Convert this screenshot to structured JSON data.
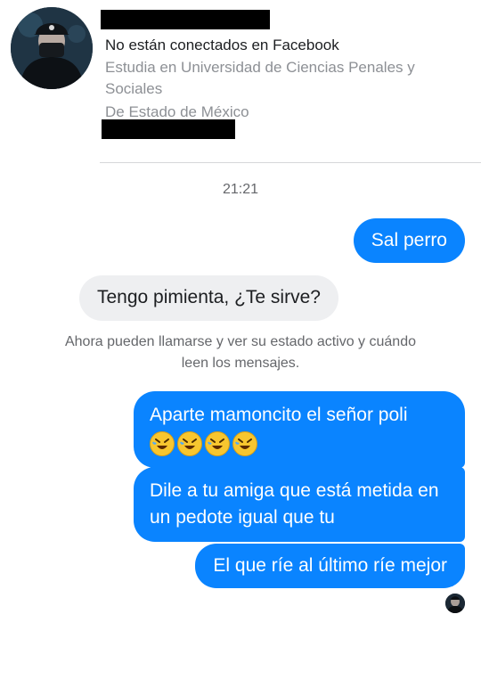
{
  "contact": {
    "status_line": "No están conectados en Facebook",
    "education": "Estudia en Universidad de Ciencias Penales y Sociales",
    "location": "De Estado de México"
  },
  "conversation": {
    "timestamp": "21:21",
    "messages": [
      {
        "direction": "outgoing",
        "text": "Sal perro"
      },
      {
        "direction": "incoming",
        "text": "Tengo pimienta, ¿Te sirve?"
      },
      {
        "direction": "outgoing",
        "text": "Aparte mamoncito el señor poli",
        "emoji": "rolling-on-floor-laughing",
        "emoji_count": 4
      },
      {
        "direction": "outgoing",
        "text": "Dile a tu amiga que está metida en un pedote igual que tu"
      },
      {
        "direction": "outgoing",
        "text": "El que ríe al último ríe mejor"
      }
    ],
    "notice": "Ahora pueden llamarse y ver su estado activo y cuándo leen los mensajes."
  },
  "colors": {
    "outgoing_bubble": "#0a84ff",
    "incoming_bubble": "#eeeff1",
    "secondary_text": "#8d9095"
  }
}
